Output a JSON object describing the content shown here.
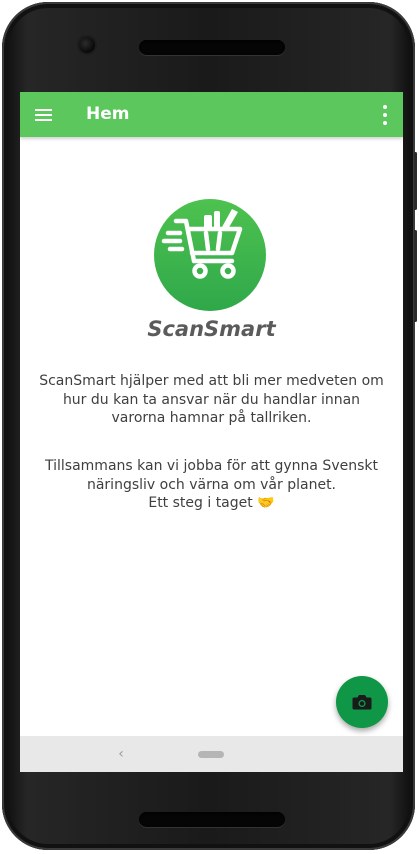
{
  "appbar": {
    "title": "Hem",
    "menu_icon": "hamburger-menu-icon",
    "overflow_icon": "more-vertical-icon",
    "color": "#5bc75c"
  },
  "main": {
    "logo_icon": "shopping-cart-icon",
    "app_name": "ScanSmart",
    "paragraph_1": "ScanSmart hjälper med att bli mer medveten om hur du kan ta ansvar när du handlar innan varorna hamnar på tallriken.",
    "paragraph_2_line_1": "Tillsammans kan vi jobba för att gynna Svenskt näringsliv och värna om vår planet.",
    "paragraph_2_line_2": "Ett steg i taget 🤝",
    "logo_color": "#3db54c"
  },
  "fab": {
    "icon": "camera-icon",
    "color": "#0f9646"
  },
  "system_nav": {
    "back_icon": "back-chevron-icon",
    "home_icon": "home-pill-icon",
    "back_glyph": "‹"
  }
}
